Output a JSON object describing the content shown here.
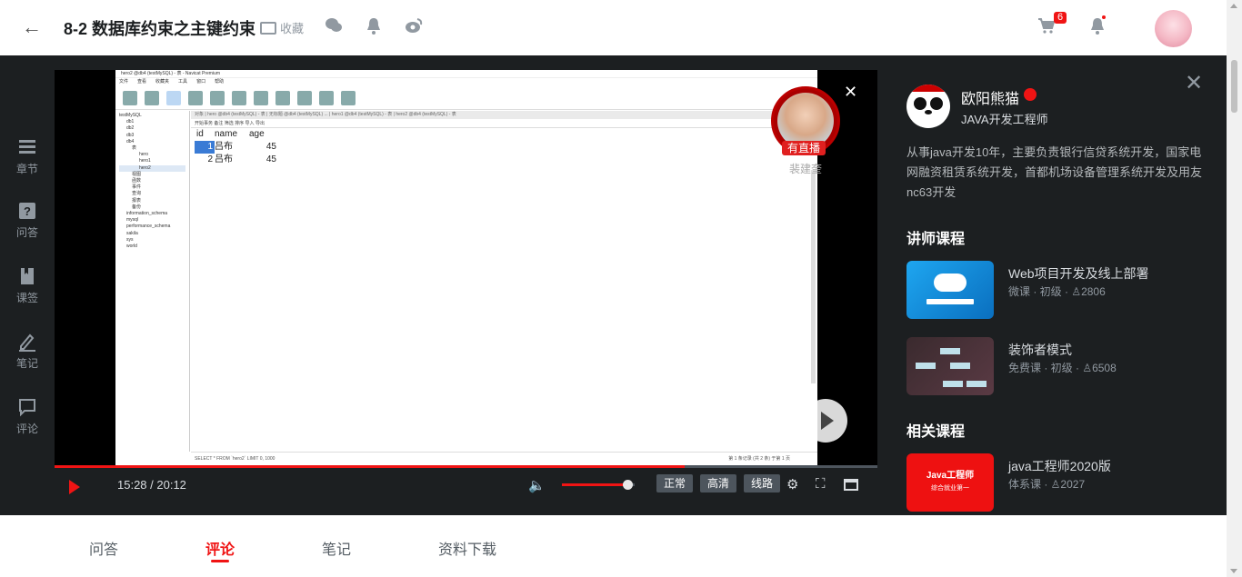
{
  "header": {
    "title": "8-2 数据库约束之主键约束",
    "favorite_label": "收藏",
    "cart_count": "6"
  },
  "left_nav": [
    {
      "label": "章节"
    },
    {
      "label": "问答"
    },
    {
      "label": "课签"
    },
    {
      "label": "笔记"
    },
    {
      "label": "评论"
    }
  ],
  "navicat": {
    "window_title": "hero2 @db4 (testMySQL) - 表 - Navicat Premium",
    "menu": [
      "文件",
      "查看",
      "收藏夹",
      "工具",
      "窗口",
      "帮助"
    ],
    "tree": [
      "testMySQL",
      "db1",
      "db2",
      "db3",
      "db4",
      "表",
      "hero",
      "hero1",
      "hero2",
      "视图",
      "函数",
      "事件",
      "查询",
      "报表",
      "备份",
      "information_schema",
      "mysql",
      "performance_schema",
      "sakila",
      "sys",
      "world"
    ],
    "tabs_text": "对象 | hero @db4 (testMySQL) - 表 | 无标题 @db4 (testMySQL) ... | hero1 @db4 (testMySQL) - 表 | hero2 @db4 (testMySQL) - 表",
    "subbar": "开始事务   备注   筛选   排序   导入   导出",
    "columns": [
      "id",
      "name",
      "age"
    ],
    "rows": [
      [
        "1",
        "吕布",
        "45"
      ],
      [
        "2",
        "吕布",
        "45"
      ]
    ],
    "status_left": "SELECT * FROM `hero2` LIMIT 0, 1000",
    "status_right": "第 1 条记录 (共 2 条) 于第 1 页"
  },
  "live": {
    "badge": "有直播",
    "name": "裴建奎"
  },
  "player": {
    "time": "15:28 / 20:12",
    "progress": 0.766,
    "volume": 0.9,
    "btn_normal": "正常",
    "btn_hd": "高清",
    "btn_line": "线路"
  },
  "teacher": {
    "name": "欧阳熊猫",
    "role": "JAVA开发工程师",
    "desc": "从事java开发10年，主要负责银行信贷系统开发，国家电网融资租赁系统开发，首都机场设备管理系统开发及用友nc63开发"
  },
  "teacher_courses_title": "讲师课程",
  "teacher_courses": [
    {
      "name": "Web项目开发及线上部署",
      "meta": "微课 · 初级 · ♙2806"
    },
    {
      "name": "装饰者模式",
      "meta": "免费课 · 初级 · ♙6508"
    }
  ],
  "related_title": "相关课程",
  "related_courses": [
    {
      "name": "java工程师2020版",
      "meta": "体系课 · ♙2027",
      "thumb_title": "Java工程师",
      "thumb_sub": "综合就业第一"
    }
  ],
  "bottom_tabs": [
    "问答",
    "评论",
    "笔记",
    "资料下载"
  ],
  "colors": {
    "accent": "#f01414",
    "dark_bg": "#1c1f21"
  }
}
